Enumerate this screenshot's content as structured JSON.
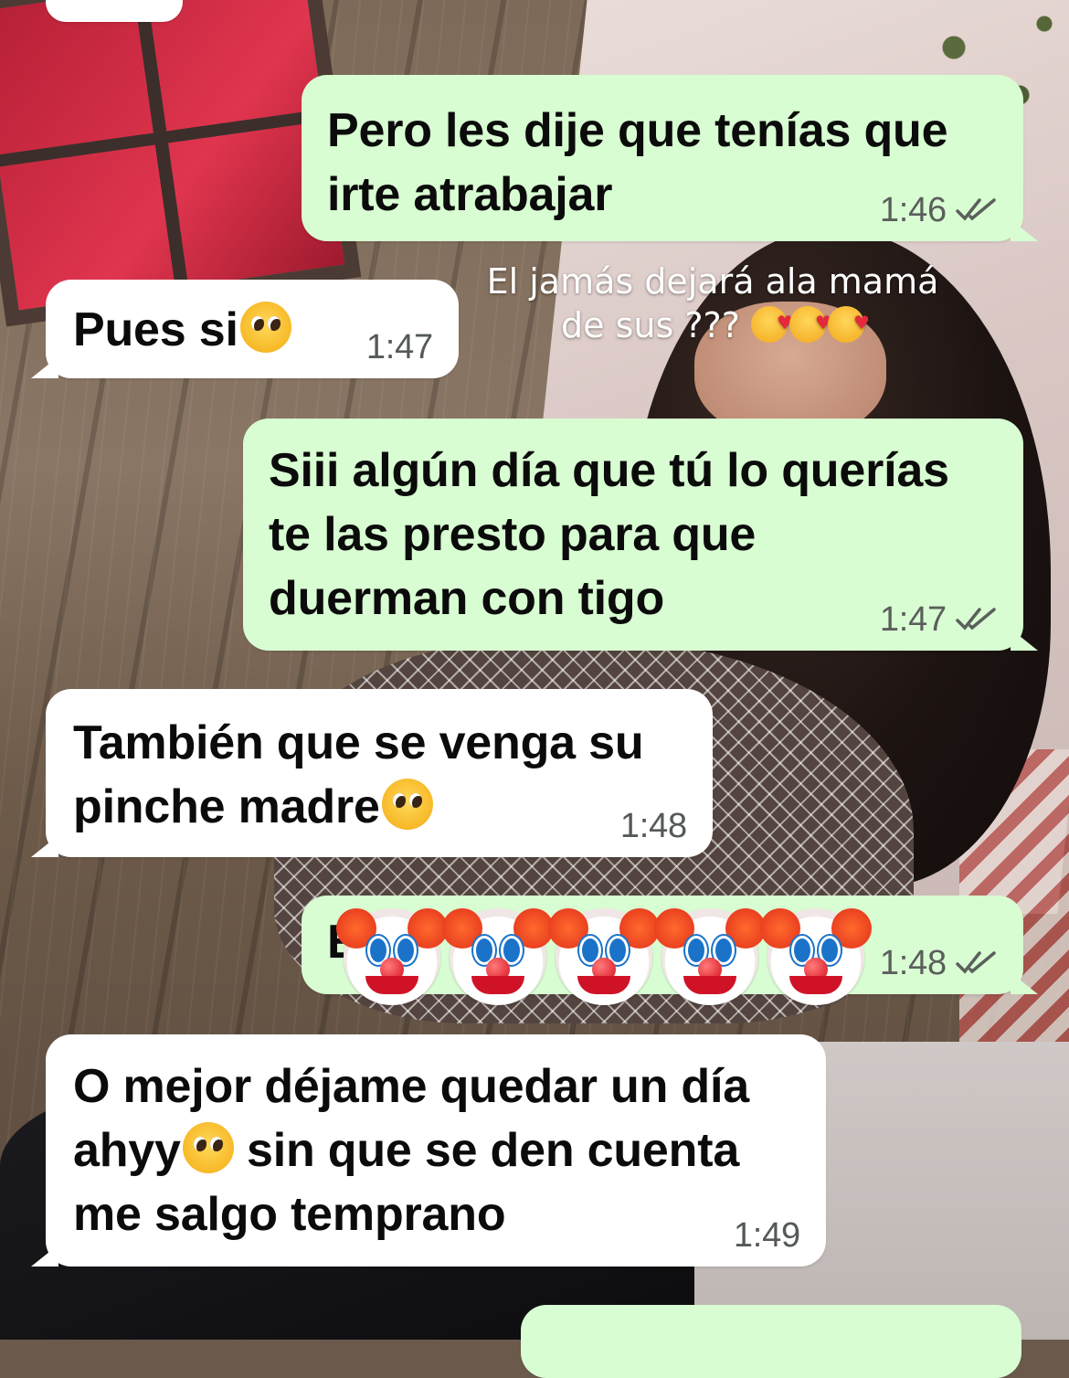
{
  "overlay_caption": {
    "line1": "El jamás dejará ala mamá",
    "line2": "de sus ???",
    "emojis": [
      "smiling-face-with-hearts",
      "smiling-face-with-hearts",
      "smiling-face-with-hearts"
    ]
  },
  "messages": [
    {
      "id": "m0",
      "direction": "incoming",
      "text": "",
      "time": ""
    },
    {
      "id": "m1",
      "direction": "outgoing",
      "text": "Pero les dije que tenías que\nirte atrabajar",
      "time": "1:46",
      "status": "read-double-check"
    },
    {
      "id": "m2",
      "direction": "incoming",
      "text": "Pues si",
      "emoji": "pleading-face",
      "time": "1:47"
    },
    {
      "id": "m3",
      "direction": "outgoing",
      "text": "Siii algún día que tú lo querías\nte las presto para que\nduerman con tigo",
      "time": "1:47",
      "status": "read-double-check"
    },
    {
      "id": "m4",
      "direction": "incoming",
      "line1": "También que se venga su",
      "line2": "pinche madre",
      "emoji": "pleading-face",
      "time": "1:48"
    },
    {
      "id": "m5",
      "direction": "outgoing",
      "text": "E",
      "time": "1:48",
      "status": "read-double-check",
      "sticker_overlay": [
        "clown-face",
        "clown-face",
        "clown-face",
        "clown-face",
        "clown-face"
      ]
    },
    {
      "id": "m6",
      "direction": "incoming",
      "line1": "O mejor déjame quedar un día",
      "line2a": "ahyy",
      "line2b": " sin que se den cuenta",
      "line3": "me salgo temprano",
      "emoji": "pleading-face",
      "time": "1:49"
    },
    {
      "id": "m7",
      "direction": "outgoing",
      "text": "",
      "time": ""
    }
  ],
  "colors": {
    "incoming_bubble": "#ffffff",
    "outgoing_bubble": "#d8fdd2",
    "read_ticks": "#6f7370",
    "text": "#0b0b0b"
  }
}
